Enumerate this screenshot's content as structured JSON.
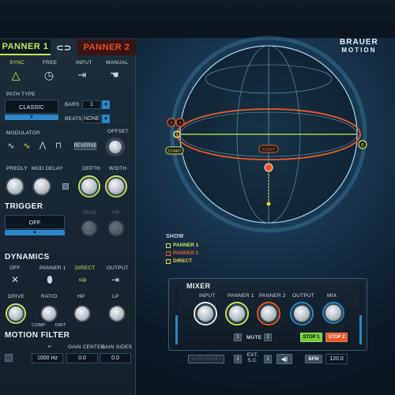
{
  "brand": {
    "line1": "BRAUER",
    "line2": "MOTION"
  },
  "tabs": {
    "panner1": "PANNER 1",
    "link_icon": "link-icon",
    "panner2": "PANNER 2"
  },
  "modes": [
    "SYNC",
    "FREE",
    "INPUT",
    "MANUAL"
  ],
  "path_type": {
    "label": "PATH TYPE",
    "value": "CLASSIC",
    "bars_label": "BARS",
    "bars_value": "1",
    "beats_label": "BEATS",
    "beats_value": "NONE"
  },
  "modulator": {
    "label": "MODULATOR",
    "reverse": "REVERSE",
    "offset": "OFFSET"
  },
  "knob_labels": {
    "predly": "PREDLY",
    "mod_delay": "MOD DELAY",
    "depth": "DEPTH",
    "width": "WIDTH"
  },
  "trigger": {
    "title": "TRIGGER",
    "value": "OFF",
    "sens": "SENS",
    "hp": "HP"
  },
  "dynamics": {
    "title": "DYNAMICS",
    "sources": [
      "OFF",
      "PANNER 1",
      "DIRECT",
      "OUTPUT"
    ],
    "knobs": [
      "DRIVE",
      "RATIO",
      "HP",
      "LP"
    ],
    "comp": "COMP",
    "dirt": "DIRT"
  },
  "motion_filter": {
    "title": "MOTION FILTER",
    "freq_value": "1000 Hz",
    "gain_center_label": "GAIN CENTER",
    "gain_center_value": "0.0",
    "gain_sides_label": "GAIN SIDES",
    "gain_sides_value": "0.0"
  },
  "sphere": {
    "start_top": "START",
    "start_mid": "START",
    "marker_a": "A",
    "marker_b": "B",
    "marker_a_orange": "A"
  },
  "show": {
    "label": "SHOW",
    "items": [
      "PANNER 1",
      "PANNER 2",
      "DIRECT"
    ]
  },
  "mixer": {
    "title": "MIXER",
    "knobs": [
      "INPUT",
      "PANNER 1",
      "PANNER 2",
      "OUTPUT",
      "MIX"
    ],
    "mute_label": "MUTE",
    "mute_1": "1",
    "mute_2": "2",
    "stop1": "STOP 1",
    "stop2": "STOP 2"
  },
  "bottom": {
    "auto_reset": "AUTO RESET",
    "num1": "1",
    "ext_sc": "EXT. S.C.",
    "num2": "2",
    "bpm_label": "BPM",
    "bpm_value": "120.0"
  },
  "colors": {
    "lime": "#c8e85a",
    "orange": "#e8582a",
    "yellow": "#f0d040",
    "blue": "#2a86c8"
  }
}
